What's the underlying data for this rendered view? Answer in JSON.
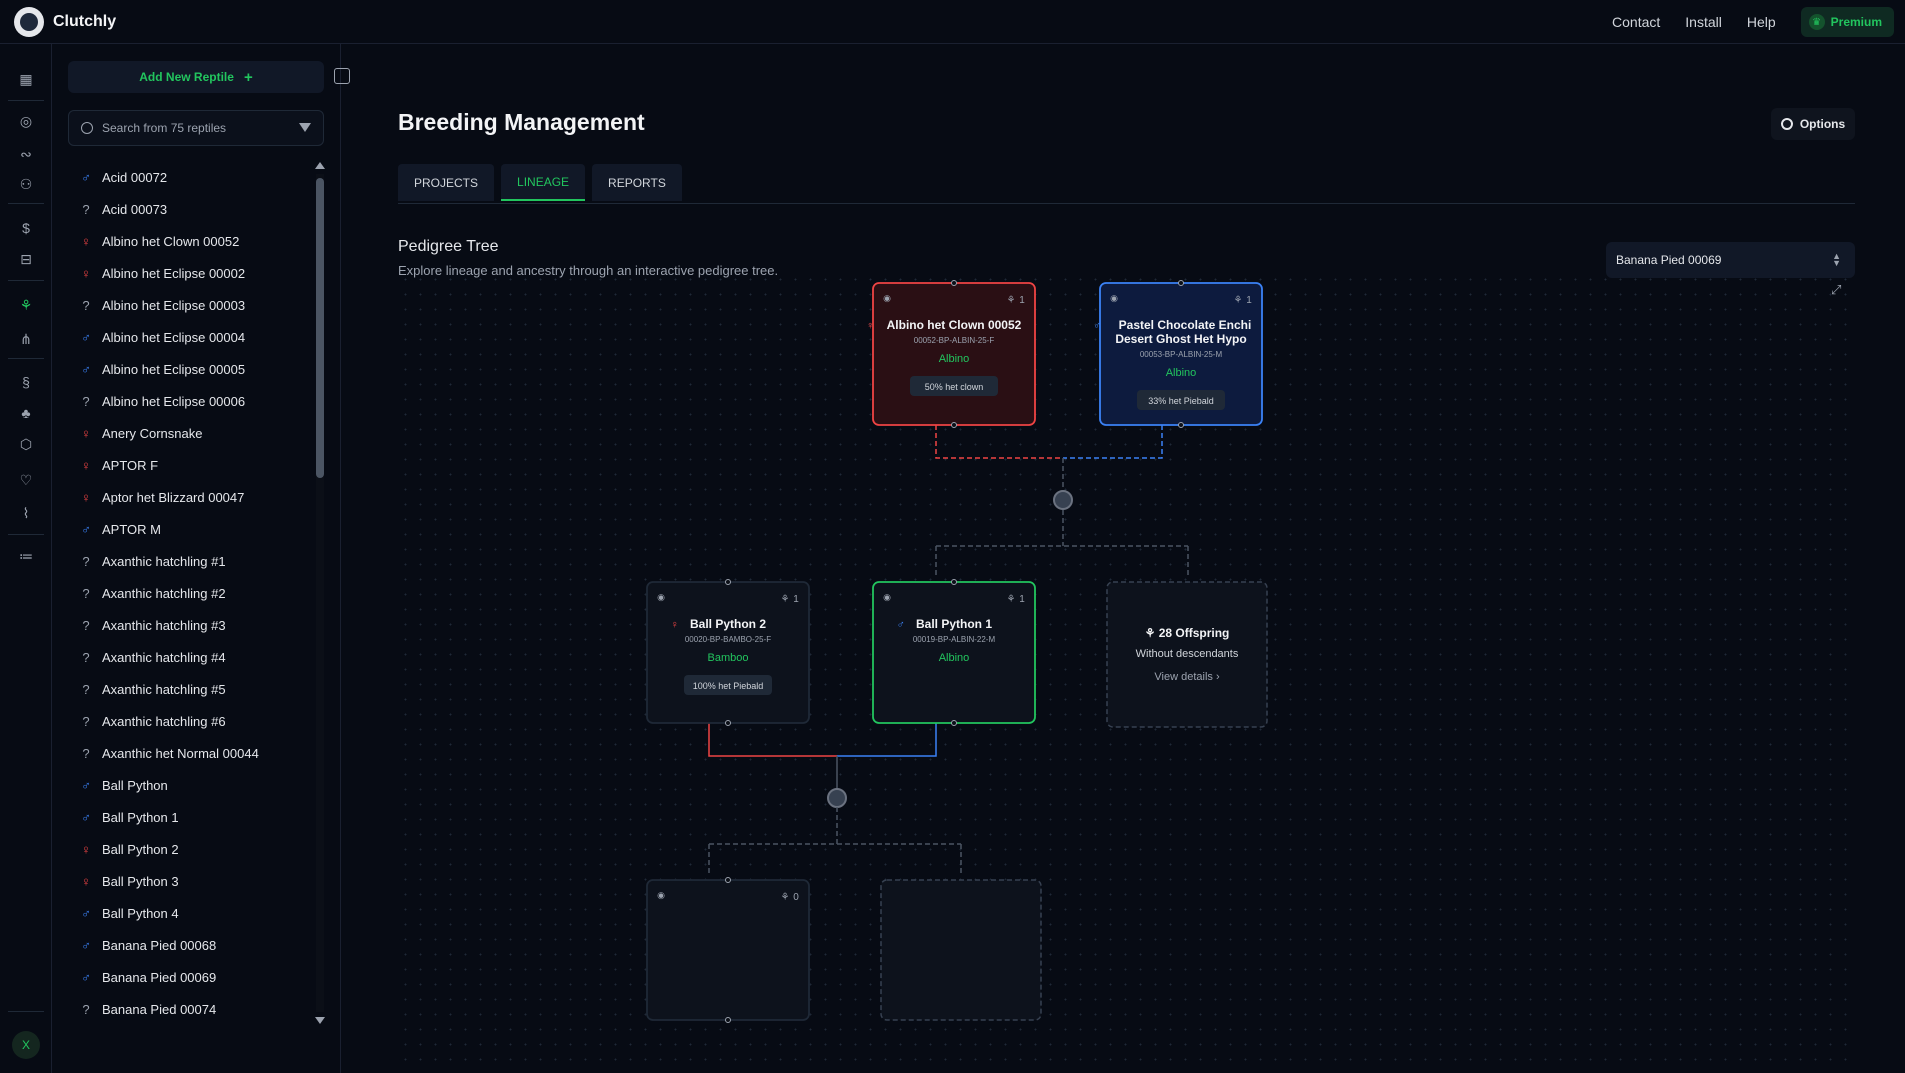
{
  "app": {
    "name": "Clutchly"
  },
  "topnav": {
    "contact": "Contact",
    "install": "Install",
    "help": "Help",
    "premium": "Premium"
  },
  "rail": {
    "avatar_letter": "X"
  },
  "sidebar": {
    "add_label": "Add New Reptile",
    "search_placeholder": "Search from 75 reptiles",
    "items": [
      {
        "name": "Acid 00072",
        "sex": "male"
      },
      {
        "name": "Acid 00073",
        "sex": "unknown"
      },
      {
        "name": "Albino het Clown 00052",
        "sex": "female"
      },
      {
        "name": "Albino het Eclipse 00002",
        "sex": "female"
      },
      {
        "name": "Albino het Eclipse 00003",
        "sex": "unknown"
      },
      {
        "name": "Albino het Eclipse 00004",
        "sex": "male"
      },
      {
        "name": "Albino het Eclipse 00005",
        "sex": "male"
      },
      {
        "name": "Albino het Eclipse 00006",
        "sex": "unknown"
      },
      {
        "name": "Anery Cornsnake",
        "sex": "female"
      },
      {
        "name": "APTOR F",
        "sex": "female"
      },
      {
        "name": "Aptor het Blizzard 00047",
        "sex": "female"
      },
      {
        "name": "APTOR M",
        "sex": "male"
      },
      {
        "name": "Axanthic hatchling #1",
        "sex": "unknown"
      },
      {
        "name": "Axanthic hatchling #2",
        "sex": "unknown"
      },
      {
        "name": "Axanthic hatchling #3",
        "sex": "unknown"
      },
      {
        "name": "Axanthic hatchling #4",
        "sex": "unknown"
      },
      {
        "name": "Axanthic hatchling #5",
        "sex": "unknown"
      },
      {
        "name": "Axanthic hatchling #6",
        "sex": "unknown"
      },
      {
        "name": "Axanthic het Normal 00044",
        "sex": "unknown"
      },
      {
        "name": "Ball Python",
        "sex": "male"
      },
      {
        "name": "Ball Python 1",
        "sex": "male"
      },
      {
        "name": "Ball Python 2",
        "sex": "female"
      },
      {
        "name": "Ball Python 3",
        "sex": "female"
      },
      {
        "name": "Ball Python 4",
        "sex": "male"
      },
      {
        "name": "Banana Pied 00068",
        "sex": "male"
      },
      {
        "name": "Banana Pied 00069",
        "sex": "male"
      },
      {
        "name": "Banana Pied 00074",
        "sex": "unknown"
      }
    ]
  },
  "main": {
    "title": "Breeding Management",
    "options_label": "Options",
    "tabs": [
      "PROJECTS",
      "LINEAGE",
      "REPORTS"
    ],
    "section_title": "Pedigree Tree",
    "section_desc": "Explore lineage and ancestry through an interactive pedigree tree.",
    "selected_reptile": "Banana Pied 00069"
  },
  "tree": {
    "nodes": [
      {
        "key": "dam",
        "name": "Albino het Clown 00052",
        "code": "00052-BP-ALBIN-25-F",
        "morph": "Albino",
        "tag": "50% het clown",
        "count": "1",
        "sex": "female"
      },
      {
        "key": "sire",
        "name": "Pastel Chocolate Enchi Desert Ghost Het Hypo",
        "code": "00053-BP-ALBIN-25-M",
        "morph": "Albino",
        "tag": "33% het Piebald",
        "count": "1",
        "sex": "male"
      },
      {
        "key": "bp2",
        "name": "Ball Python 2",
        "code": "00020-BP-BAMBO-25-F",
        "morph": "Bamboo",
        "tag": "100% het Piebald",
        "count": "1",
        "sex": "female"
      },
      {
        "key": "bp1",
        "name": "Ball Python 1",
        "code": "00019-BP-ALBIN-22-M",
        "morph": "Albino",
        "tag": "",
        "count": "1",
        "sex": "male"
      },
      {
        "key": "child",
        "name": "",
        "code": "",
        "morph": "",
        "tag": "",
        "count": "0",
        "sex": "female"
      }
    ],
    "offspring": {
      "count_label": "28 Offspring",
      "sub": "Without descendants",
      "link": "View details"
    }
  },
  "colors": {
    "accent": "#22c55e",
    "female": "#ef4444",
    "male": "#3b82f6",
    "bg": "#070b14"
  }
}
